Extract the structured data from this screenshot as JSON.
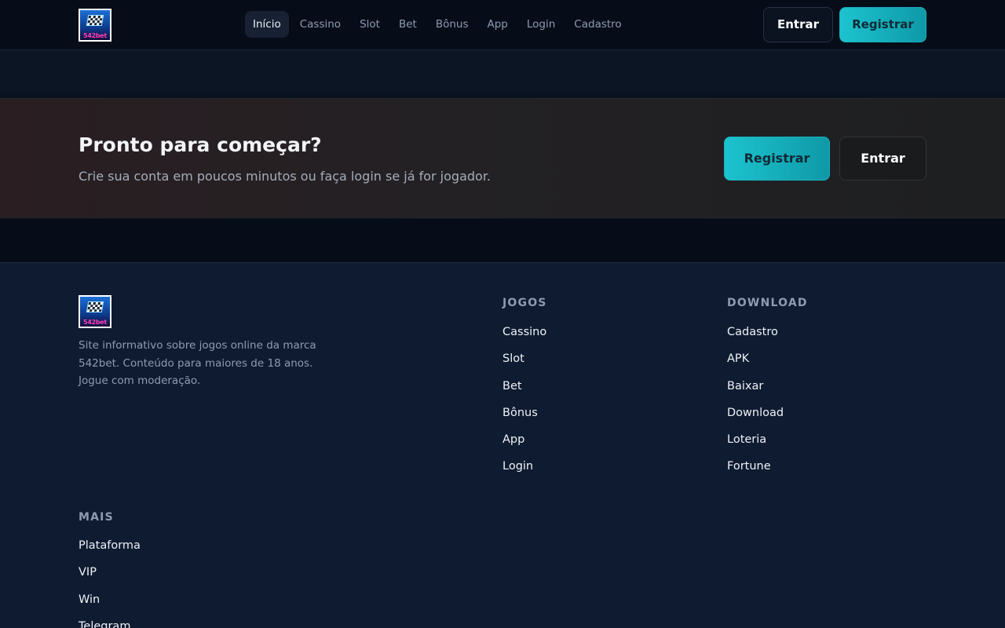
{
  "brand": {
    "logo_text": "542bet"
  },
  "header": {
    "nav": [
      {
        "label": "Início",
        "active": true
      },
      {
        "label": "Cassino"
      },
      {
        "label": "Slot"
      },
      {
        "label": "Bet"
      },
      {
        "label": "Bônus"
      },
      {
        "label": "App"
      },
      {
        "label": "Login"
      },
      {
        "label": "Cadastro"
      }
    ],
    "login_label": "Entrar",
    "register_label": "Registrar"
  },
  "cta": {
    "title": "Pronto para começar?",
    "subtitle": "Crie sua conta em poucos minutos ou faça login se já for jogador.",
    "register_label": "Registrar",
    "login_label": "Entrar"
  },
  "footer": {
    "description": "Site informativo sobre jogos online da marca 542bet. Conteúdo para maiores de 18 anos. Jogue com moderação.",
    "columns": {
      "jogos": {
        "title": "JOGOS",
        "links": [
          "Cassino",
          "Slot",
          "Bet",
          "Bônus",
          "App",
          "Login"
        ]
      },
      "download": {
        "title": "DOWNLOAD",
        "links": [
          "Cadastro",
          "APK",
          "Baixar",
          "Download",
          "Loteria",
          "Fortune"
        ]
      },
      "mais": {
        "title": "MAIS",
        "links": [
          "Plataforma",
          "VIP",
          "Win",
          "Telegram"
        ]
      }
    }
  },
  "colors": {
    "accent": "#1cc3cf",
    "header_bg": "#070d18",
    "footer_bg": "#0e1b30"
  }
}
